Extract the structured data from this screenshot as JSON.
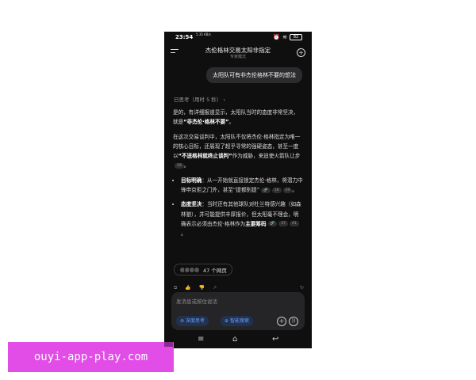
{
  "status_bar": {
    "time": "23:54",
    "net": "5.35 KB/s",
    "battery": "82"
  },
  "header": {
    "title": "杰伦格林交易太阳非指定",
    "subtitle": "专家模式"
  },
  "user_message": "太阳队可有非杰伦格林不要的想法",
  "thinking_label": "已思考（用时 5 秒）",
  "answer": {
    "p1_a": "是的，有详细报道显示，太阳队当时的态度非常坚决，就是",
    "p1_b": "“非杰伦·格林不要”",
    "p1_c": "。",
    "p2_a": "在这次交易谈判中，太阳队不仅将杰伦·格林指定为唯一的核心目标，还展现了超乎寻常的强硬姿态，甚至一度以",
    "p2_b": "“不送格林就终止谈判”",
    "p2_c": "作为威胁，来迫使火箭队让步",
    "p2_ref": "19",
    "p2_d": "。",
    "b1_label": "目标明确",
    "b1_text": "：从一开始就直接锁定杰伦·格林，将潜力中锋申京拒之门外，甚至“提都别提”",
    "b1_refs": [
      "18",
      "19"
    ],
    "b1_end": "。",
    "b2_label": "态度坚决",
    "b2_text": "：当时还有其他球队对杜兰特感兴趣（如森林狼），并可能提供丰厚报价，但太阳毫不理会，明确表示必须由杰伦·格林作为",
    "b2_bold": "主要筹码",
    "b2_refs": [
      "37",
      "41"
    ],
    "b2_end": "。"
  },
  "sources_label": "47 个网页",
  "composer": {
    "placeholder": "发消息或按住说话",
    "deep_think": "深度思考",
    "smart_search": "智能搜索"
  },
  "watermark": "ouyi-app-play.com",
  "colors": {
    "phone_bg": "#0f0f0f",
    "bubble": "#2c2c2e",
    "chip_text": "#6f9cf5",
    "watermark_bg": "#e14de6"
  }
}
